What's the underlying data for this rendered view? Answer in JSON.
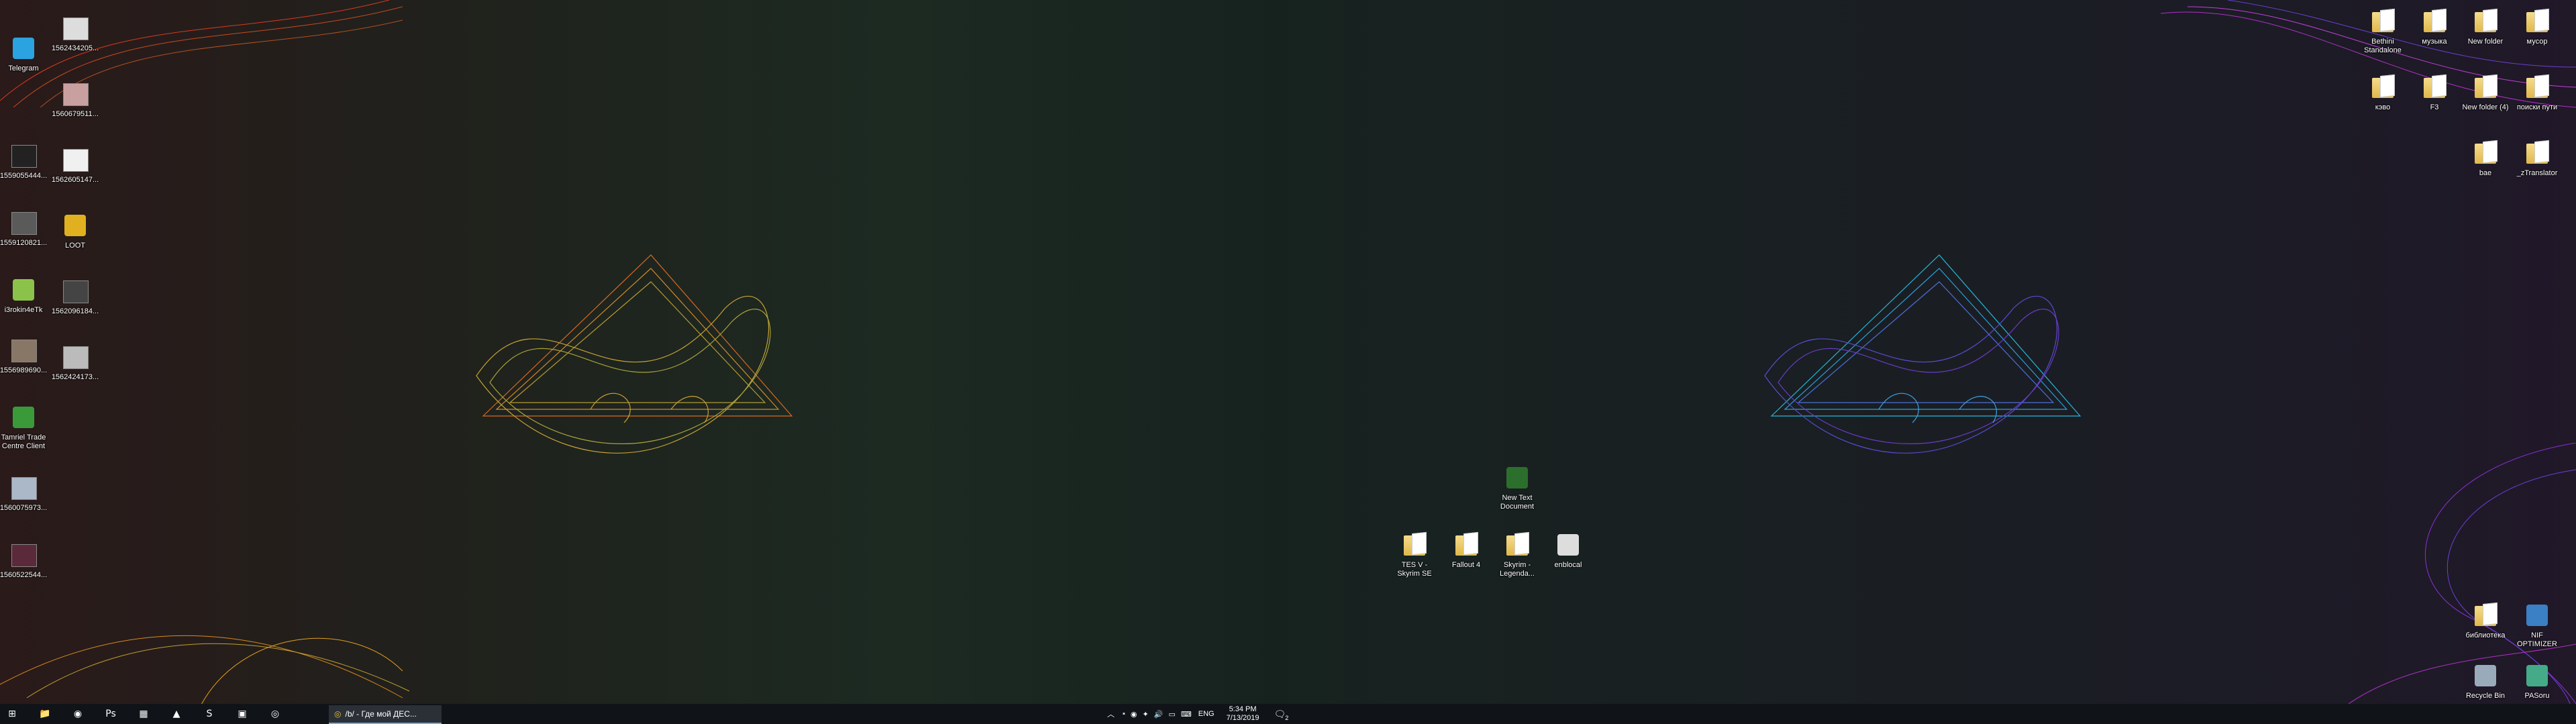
{
  "desktop_left": {
    "icons_col1": [
      {
        "label": "Tamriel Trade Centre Client"
      }
    ],
    "icons": [
      {
        "label": "Telegram",
        "kind": "app",
        "color": "#2aa3e0",
        "icon": "telegram-icon"
      },
      {
        "label": "1559055444...",
        "kind": "thumb",
        "color": "#222"
      },
      {
        "label": "1559120821...",
        "kind": "thumb",
        "color": "#5a5a5a"
      },
      {
        "label": "i3rokin4eTk",
        "kind": "app",
        "color": "#8bc34a",
        "icon": "game-icon"
      },
      {
        "label": "1556989690...",
        "kind": "thumb",
        "color": "#887766"
      },
      {
        "label": "Tamriel Trade Centre Client",
        "kind": "app",
        "color": "#3a9a3a",
        "icon": "ttc-icon"
      },
      {
        "label": "1560075973...",
        "kind": "thumb",
        "color": "#aab8c8"
      },
      {
        "label": "1560522544...",
        "kind": "thumb",
        "color": "#5a2a3a"
      }
    ],
    "icons_col2": [
      {
        "label": "1562434205...",
        "kind": "thumb",
        "color": "#ddd"
      },
      {
        "label": "1560679511...",
        "kind": "thumb",
        "color": "#c9a0a0"
      },
      {
        "label": "1562605147...",
        "kind": "thumb",
        "color": "#f0f0f0"
      },
      {
        "label": "LOOT",
        "kind": "app",
        "color": "#e0b020",
        "icon": "loot-icon"
      },
      {
        "label": "1562096184...",
        "kind": "thumb",
        "color": "#444"
      },
      {
        "label": "1562424173...",
        "kind": "thumb",
        "color": "#bbb"
      }
    ]
  },
  "desktop_center": [
    {
      "label": "New Text Document",
      "kind": "app",
      "color": "#2c6e2c",
      "icon": "notepad-icon"
    },
    {
      "label": "TES V - Skyrim SE",
      "kind": "folder"
    },
    {
      "label": "Fallout 4",
      "kind": "folder"
    },
    {
      "label": "Skyrim - Legenda...",
      "kind": "folder"
    },
    {
      "label": "enblocal",
      "kind": "app",
      "color": "#ddd",
      "icon": "settings-file-icon"
    }
  ],
  "desktop_right": [
    {
      "label": "Bethini Standalone",
      "kind": "folder"
    },
    {
      "label": "музыка",
      "kind": "folder"
    },
    {
      "label": "New folder",
      "kind": "folder"
    },
    {
      "label": "мусор",
      "kind": "folder"
    },
    {
      "label": "кэво",
      "kind": "folder"
    },
    {
      "label": "F3",
      "kind": "folder"
    },
    {
      "label": "New folder (4)",
      "kind": "folder"
    },
    {
      "label": "поиски пути",
      "kind": "folder"
    },
    {
      "label": "bae",
      "kind": "folder"
    },
    {
      "label": "_zTranslator",
      "kind": "folder"
    },
    {
      "label": "библиотека",
      "kind": "folder"
    },
    {
      "label": "NIF OPTIMIZER",
      "kind": "app",
      "color": "#3b7fc4",
      "icon": "nif-icon"
    },
    {
      "label": "Recycle Bin",
      "kind": "app",
      "color": "#9ab",
      "icon": "recycle-bin-icon"
    },
    {
      "label": "PASoru",
      "kind": "app",
      "color": "#4a8",
      "icon": "app-icon"
    }
  ],
  "taskbar": {
    "apps": [
      {
        "name": "start-button",
        "glyph": "⊞"
      },
      {
        "name": "file-explorer",
        "glyph": "📁"
      },
      {
        "name": "steam",
        "glyph": "◉"
      },
      {
        "name": "photoshop",
        "glyph": "Ps"
      },
      {
        "name": "app-4",
        "glyph": "▦"
      },
      {
        "name": "app-5",
        "glyph": "▲"
      },
      {
        "name": "app-6",
        "glyph": "S"
      },
      {
        "name": "app-7",
        "glyph": "▣"
      },
      {
        "name": "chrome",
        "glyph": "◎"
      }
    ],
    "chrome_tab_label": "/b/ - Где мой ДЕС...",
    "tray_lang": "ENG",
    "time": "5:34 PM",
    "date": "7/13/2019",
    "notif_count": "2"
  }
}
